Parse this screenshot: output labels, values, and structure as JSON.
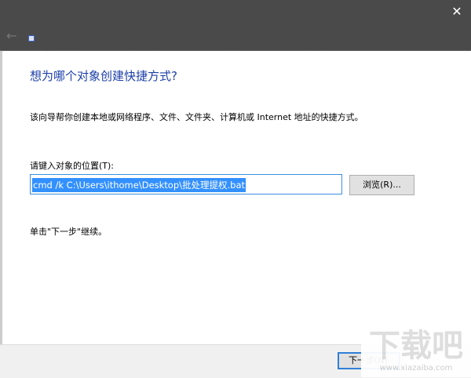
{
  "titlebar": {
    "close_icon": "close-icon",
    "back_icon": "back-arrow-icon"
  },
  "heading": "想为哪个对象创建快捷方式?",
  "description": "该向导帮你创建本地或网络程序、文件、文件夹、计算机或 Internet 地址的快捷方式。",
  "location_label": "请键入对象的位置(T):",
  "location_value": "cmd /k C:\\Users\\ithome\\Desktop\\批处理提权.bat",
  "browse_label": "浏览(R)...",
  "hint": "单击\"下一步\"继续。",
  "next_label": "下一步(N)",
  "watermark": {
    "logo": "下载吧",
    "url": "www.xiazaiba.com"
  }
}
